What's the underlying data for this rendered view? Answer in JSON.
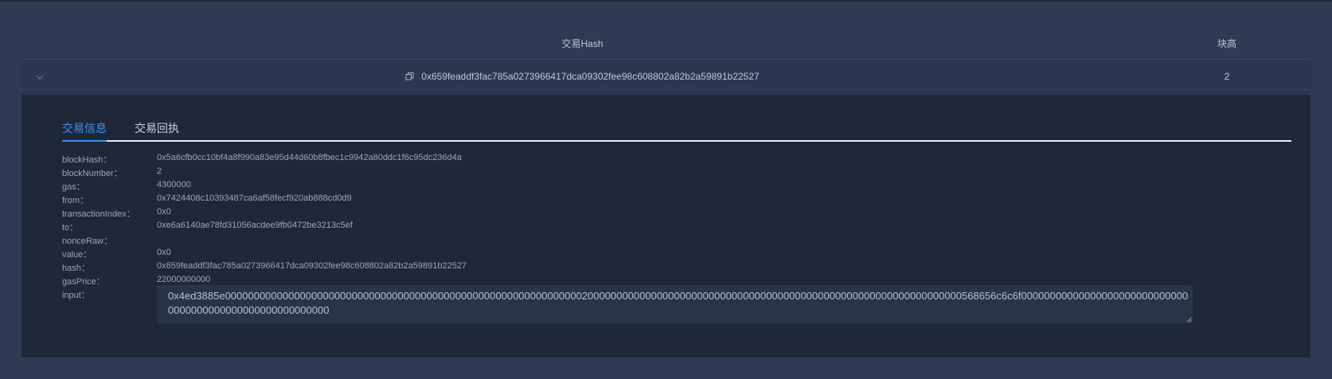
{
  "table": {
    "headers": {
      "hash": "交易Hash",
      "height": "块高"
    },
    "rows": [
      {
        "hash": "0x659feaddf3fac785a0273966417dca09302fee98c608802a82b2a59891b22527",
        "height": "2"
      }
    ]
  },
  "detail": {
    "tabs": [
      {
        "label": "交易信息",
        "active": true
      },
      {
        "label": "交易回执",
        "active": false
      }
    ],
    "fields": [
      {
        "label": "blockHash：",
        "value": "0x5a6cfb0cc10bf4a8f990a83e95d44d60b8fbec1c9942a80ddc1f6c95dc236d4a"
      },
      {
        "label": "blockNumber：",
        "value": "2"
      },
      {
        "label": "gas：",
        "value": "4300000"
      },
      {
        "label": "from：",
        "value": "0x7424408c10393487ca6af58fecf920ab888cd0d9"
      },
      {
        "label": "transactionIndex：",
        "value": "0x0"
      },
      {
        "label": "to：",
        "value": "0xe6a6140ae78fd31056acdee9fb0472be3213c5ef"
      },
      {
        "label": "nonceRaw：",
        "value": ""
      },
      {
        "label": "value：",
        "value": "0x0"
      },
      {
        "label": "hash：",
        "value": "0x659feaddf3fac785a0273966417dca09302fee98c608802a82b2a59891b22527"
      },
      {
        "label": "gasPrice：",
        "value": "22000000000"
      },
      {
        "label": "input：",
        "value": ""
      }
    ],
    "input_value": "0x4ed3885e00000000000000000000000000000000000000000000000000000000000000200000000000000000000000000000000000000000000000000000000000000000568656c6c6f000000000000000000000000000000000000000000000000000000000"
  },
  "colors": {
    "accent": "#3b8ff6",
    "page_bg": "#2f3b52",
    "panel_bg": "#1f2839"
  }
}
